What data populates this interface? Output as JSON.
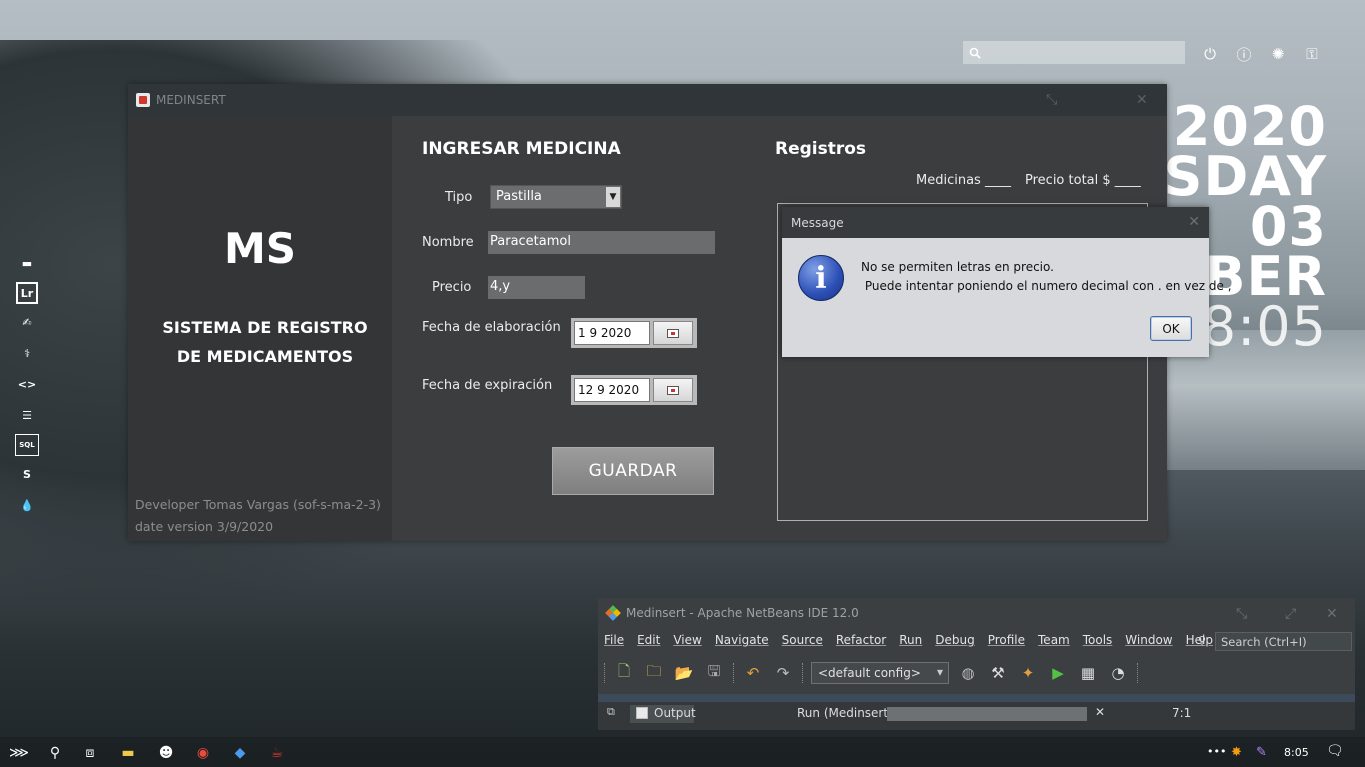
{
  "desktop": {
    "clock_lines": [
      "2020",
      "RSDAY",
      "03",
      "BER",
      "08:05"
    ]
  },
  "main_window": {
    "title": "MEDINSERT",
    "brand": "MS",
    "subtitle_line1": "SISTEMA DE REGISTRO",
    "subtitle_line2": "DE MEDICAMENTOS",
    "developer": "Developer Tomas Vargas (sof-s-ma-2-3)",
    "date_version": "date version 3/9/2020",
    "form_title": "INGRESAR MEDICINA",
    "tipo_label": "Tipo",
    "tipo_value": "Pastilla",
    "nombre_label": "Nombre",
    "nombre_value": "Paracetamol",
    "precio_label": "Precio",
    "precio_value": "4,y",
    "elab_label": "Fecha de elaboración",
    "elab_value": "1 9 2020",
    "exp_label": "Fecha de expiración",
    "exp_value": "12 9 2020",
    "save_button": "GUARDAR",
    "registros_title": "Registros",
    "medicinas_label": "Medicinas ____",
    "precio_total_label": "Precio total $ ____"
  },
  "dialog": {
    "title": "Message",
    "line1": "No se permiten letras en precio.",
    "line2": " Puede intentar poniendo el numero decimal con . en vez de ,",
    "ok": "OK"
  },
  "netbeans": {
    "title": "Medinsert - Apache NetBeans IDE 12.0",
    "menu": [
      "File",
      "Edit",
      "View",
      "Navigate",
      "Source",
      "Refactor",
      "Run",
      "Debug",
      "Profile",
      "Team",
      "Tools",
      "Window",
      "Help"
    ],
    "search_placeholder": "Search (Ctrl+I)",
    "config": "<default config>",
    "output_tab": "Output",
    "run_label": "Run (Medinsert)",
    "position": "7:1"
  },
  "taskbar": {
    "time": "8:05"
  }
}
